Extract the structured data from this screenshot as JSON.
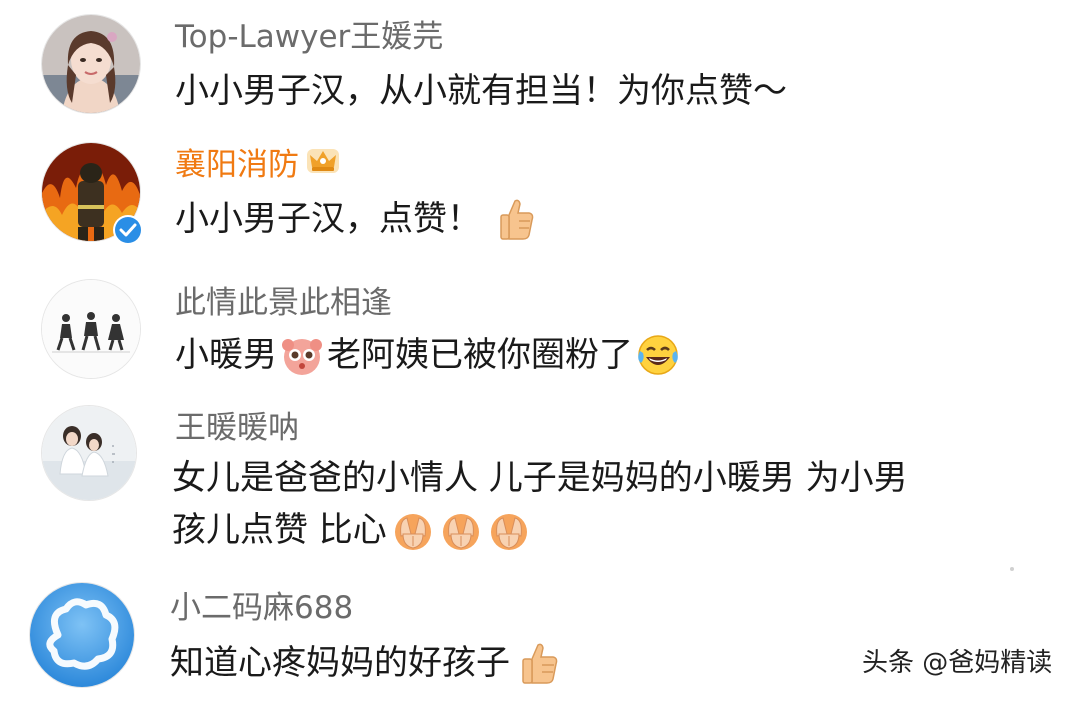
{
  "comments": [
    {
      "username": "Top-Lawyer王媛芫",
      "lines": [
        "小小男子汉，从小就有担当！为你点赞～"
      ]
    },
    {
      "username": "襄阳消防",
      "username_color": "#f07a12",
      "badge": "crown-icon",
      "verified": true,
      "lines": [
        "小小男子汉，点赞！"
      ],
      "emoji": "thumbs-up-icon"
    },
    {
      "username": "此情此景此相逢",
      "text_before": "小暖男",
      "text_after": "老阿姨已被你圈粉了",
      "emoji_1": "cute-face-icon",
      "emoji_2": "laughing-tears-icon"
    },
    {
      "username": "王暖暖呐",
      "lines": [
        "女儿是爸爸的小情人 儿子是妈妈的小暖男 为小男",
        "孩儿点赞 比心"
      ],
      "emoji": "heart-hands-icon",
      "emoji_count": 3
    },
    {
      "username": "小二码麻688",
      "lines": [
        "知道心疼妈妈的好孩子"
      ],
      "emoji": "thumbs-up-icon"
    }
  ],
  "watermark": "头条 @爸妈精读",
  "colors": {
    "username": "#6b6b6b",
    "vip_username": "#f07a12",
    "text": "#1a1a1a",
    "verified_badge": "#2a8ee6"
  }
}
